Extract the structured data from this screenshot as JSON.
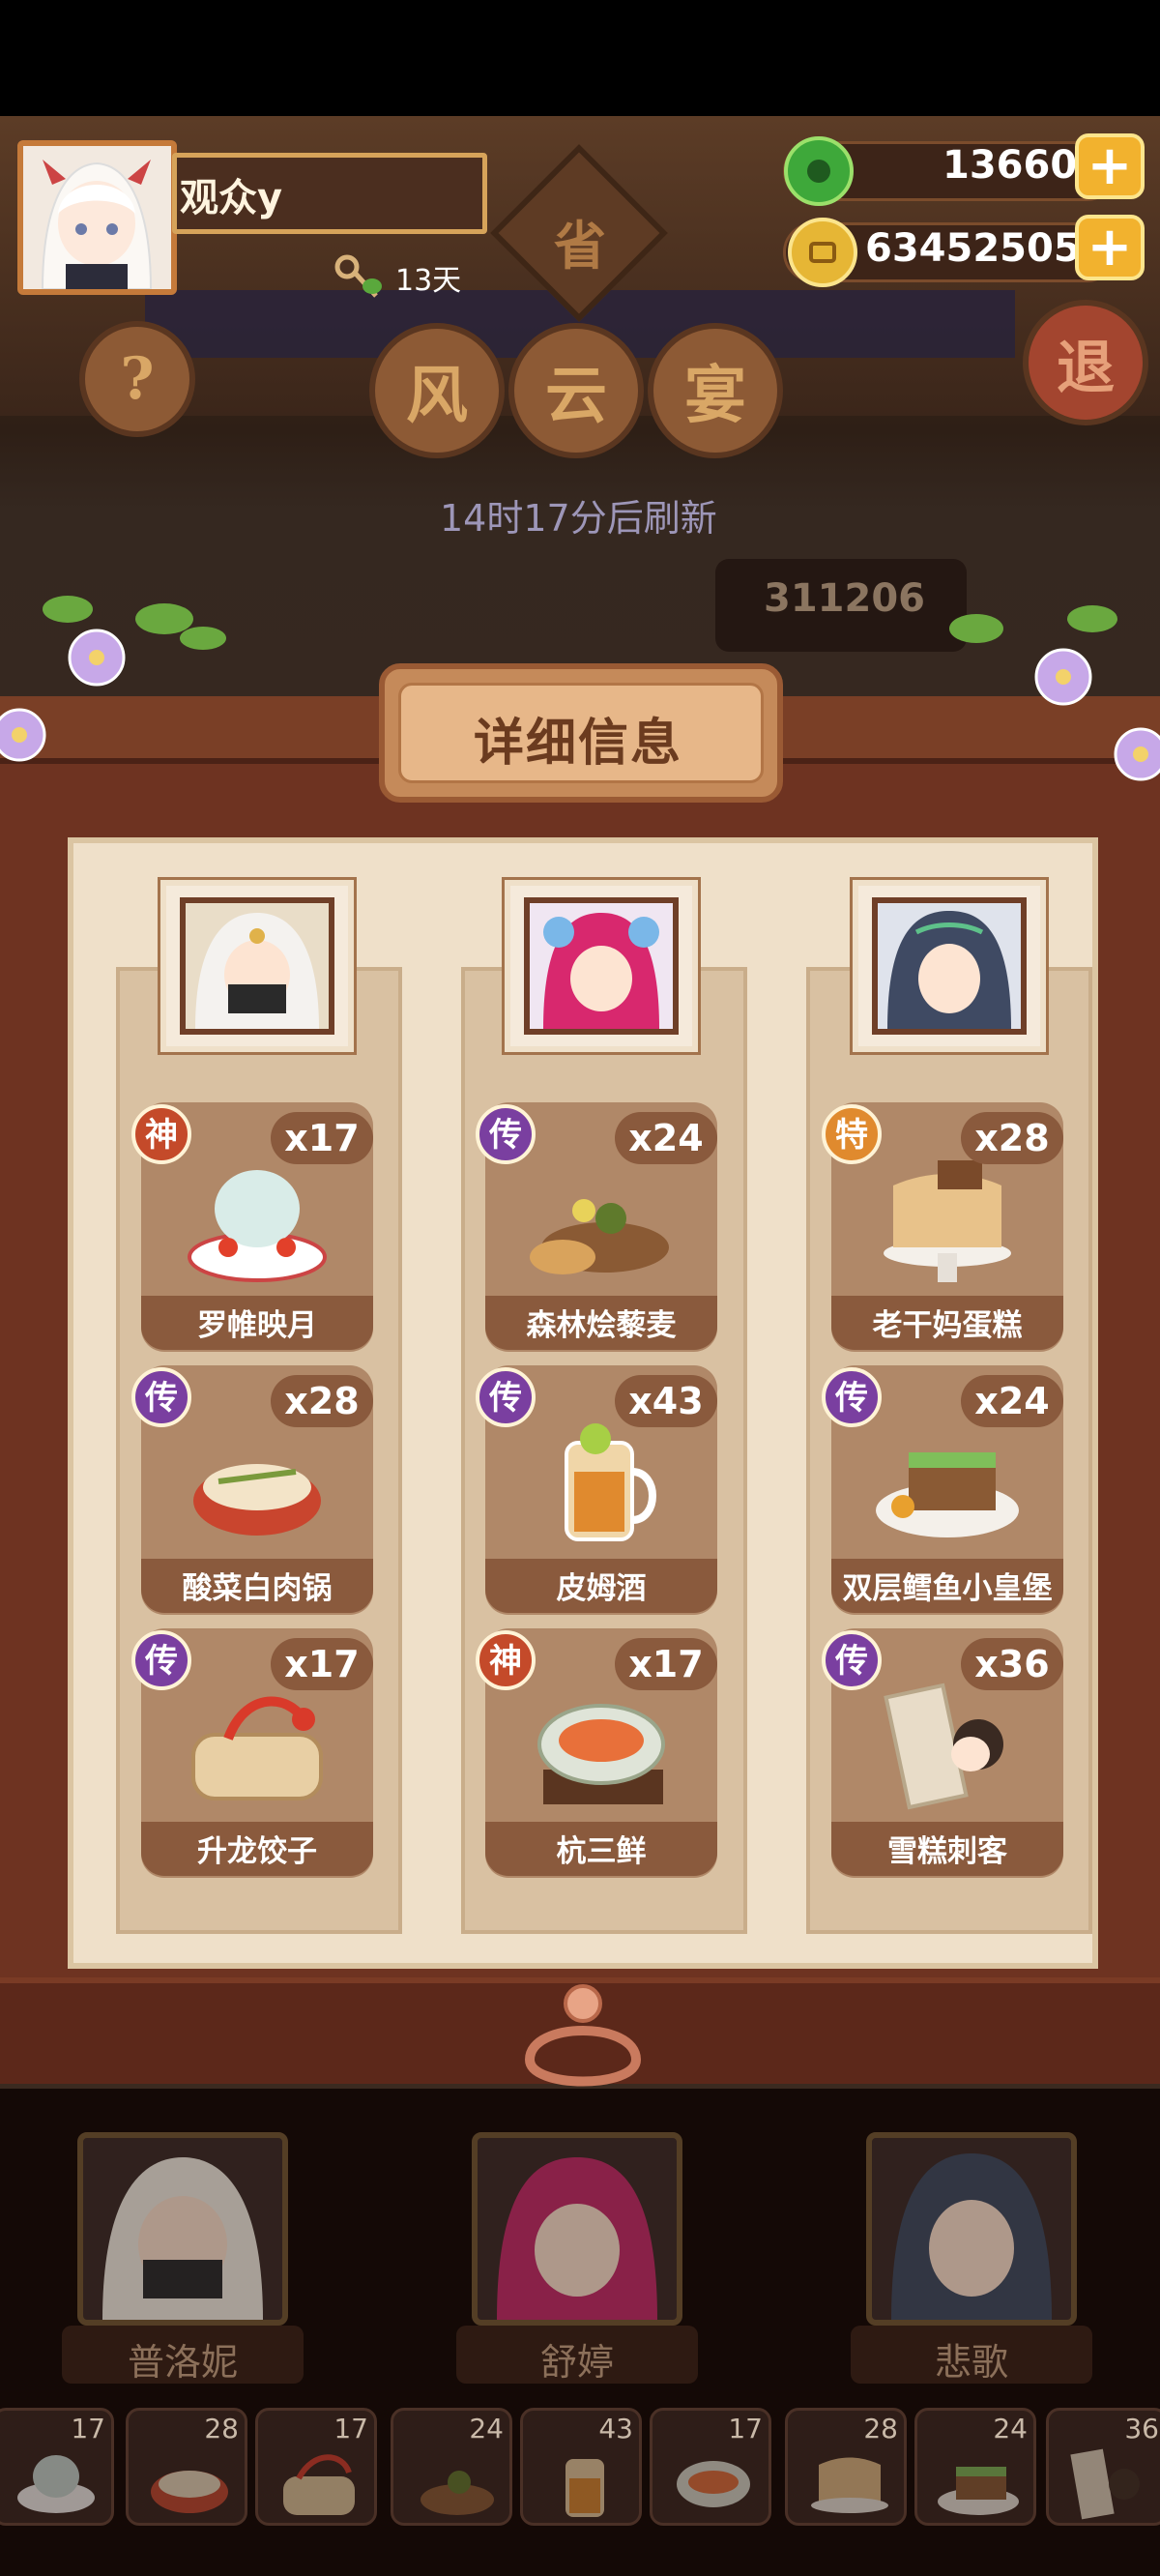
{
  "header": {
    "player_name": "观众y",
    "days_label": "13天",
    "jade_amount": "13660",
    "coin_amount": "63452505",
    "plus_label": "+",
    "help_label": "?",
    "province_label": "省",
    "banner_chars": [
      "风",
      "云",
      "宴"
    ],
    "exit_label": "退",
    "refresh_text": "14时17分后刷新",
    "score_text": "311206"
  },
  "panel": {
    "title": "详细信息"
  },
  "columns": [
    {
      "dishes": [
        {
          "rarity": "神",
          "count": "x17",
          "name": "罗帷映月"
        },
        {
          "rarity": "传",
          "count": "x28",
          "name": "酸菜白肉锅"
        },
        {
          "rarity": "传",
          "count": "x17",
          "name": "升龙饺子"
        }
      ]
    },
    {
      "dishes": [
        {
          "rarity": "传",
          "count": "x24",
          "name": "森林烩藜麦"
        },
        {
          "rarity": "传",
          "count": "x43",
          "name": "皮姆酒"
        },
        {
          "rarity": "神",
          "count": "x17",
          "name": "杭三鲜"
        }
      ]
    },
    {
      "dishes": [
        {
          "rarity": "特",
          "count": "x28",
          "name": "老干妈蛋糕"
        },
        {
          "rarity": "传",
          "count": "x24",
          "name": "双层鳕鱼小皇堡"
        },
        {
          "rarity": "传",
          "count": "x36",
          "name": "雪糕刺客"
        }
      ]
    }
  ],
  "chefs": [
    {
      "name": "普洛妮"
    },
    {
      "name": "舒婷"
    },
    {
      "name": "悲歌"
    }
  ],
  "tray": [
    "17",
    "28",
    "17",
    "24",
    "43",
    "17",
    "28",
    "24",
    "36"
  ],
  "colors": {
    "rarity_shen": "#c44a2a",
    "rarity_chuan": "#7a3fa0",
    "rarity_te": "#e08a2e",
    "coin_plus": "#f2b22e"
  }
}
